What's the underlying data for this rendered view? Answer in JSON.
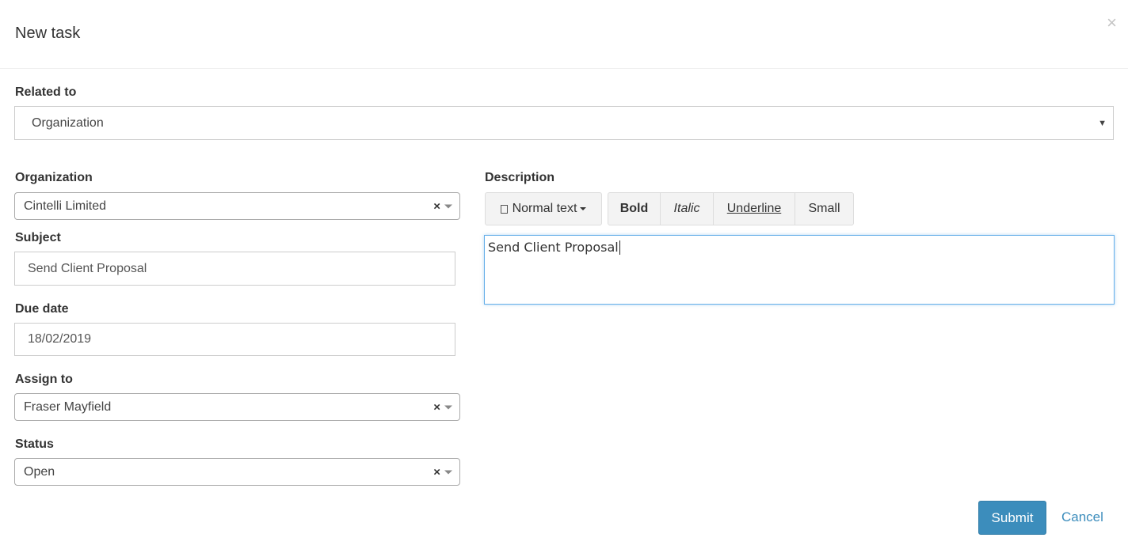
{
  "modal": {
    "title": "New task",
    "close_label": "×"
  },
  "related_to": {
    "label": "Related to",
    "value": "Organization"
  },
  "organization": {
    "label": "Organization",
    "value": "Cintelli Limited",
    "clear": "×"
  },
  "subject": {
    "label": "Subject",
    "value": "Send Client Proposal"
  },
  "due_date": {
    "label": "Due date",
    "value": "18/02/2019"
  },
  "assign_to": {
    "label": "Assign to",
    "value": "Fraser Mayfield",
    "clear": "×"
  },
  "status": {
    "label": "Status",
    "value": "Open",
    "clear": "×"
  },
  "description": {
    "label": "Description",
    "toolbar": {
      "format_label": "Normal text",
      "bold": "Bold",
      "italic": "Italic",
      "underline": "Underline",
      "small": "Small"
    },
    "content": "Send Client Proposal"
  },
  "actions": {
    "submit": "Submit",
    "cancel": "Cancel"
  },
  "colors": {
    "primary": "#3c8dbc",
    "editor_focus": "#66afe9"
  }
}
